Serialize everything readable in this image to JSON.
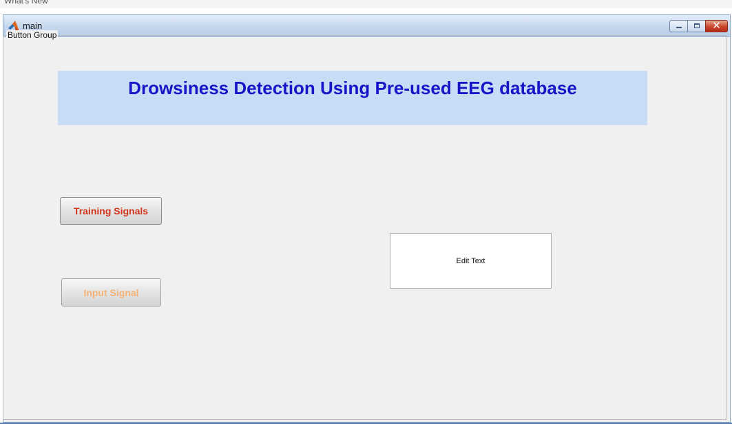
{
  "top_strip": {
    "text": "What's New"
  },
  "window": {
    "title": "main",
    "icon": "matlab-icon",
    "controls": [
      "minimize-icon",
      "maximize-icon",
      "close-icon"
    ]
  },
  "group": {
    "title": "Button Group"
  },
  "header": {
    "title": "Drowsiness Detection Using Pre-used EEG database",
    "background": "#c8dcf6",
    "title_color": "#1616c8"
  },
  "buttons": {
    "training": {
      "label": "Training Signals",
      "color": "#d0341a"
    },
    "input": {
      "label": "Input Signal",
      "color": "#f3b178"
    }
  },
  "edit": {
    "text": "Edit Text"
  }
}
